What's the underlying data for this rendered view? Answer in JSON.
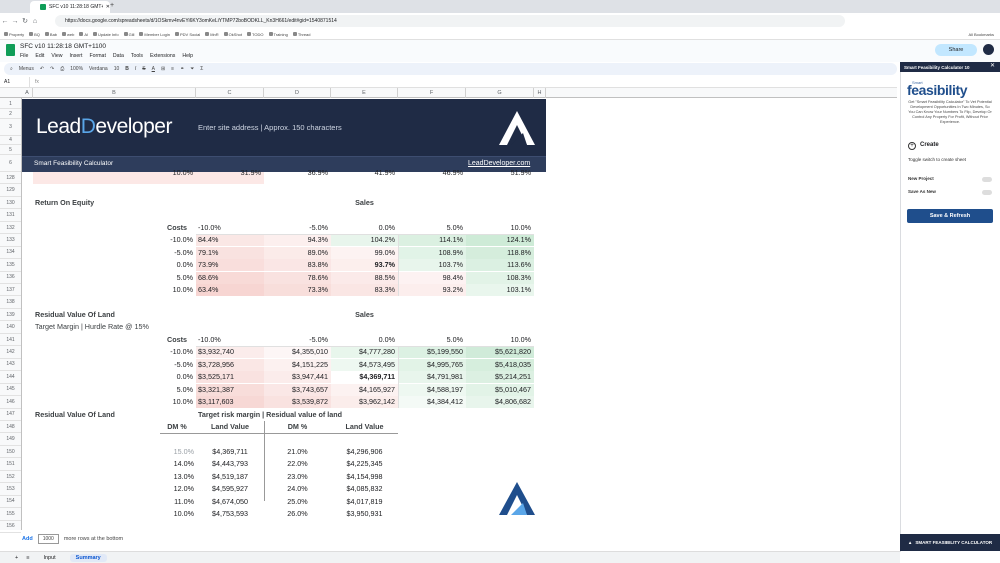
{
  "browser": {
    "tab_title": "SFC v10 11:28:18 GMT+1100",
    "url": "https://docs.google.com/spreadsheets/d/1OSkmv4nvEYi6KY3omKeLiYTMP72boBODKLL_Kn3H661/edit#gid=1540871514",
    "bookmarks": [
      "Property",
      "BQ",
      "Bab",
      "web",
      "Al",
      "Update Info",
      "Gill",
      "Member Login",
      "PDV Social",
      "MnR",
      "OkShot",
      "TODO",
      "Training",
      "Thread"
    ],
    "all_bookmarks": "All Bookmarks"
  },
  "sheet": {
    "title": "SFC v10 11:28:18 GMT+1100",
    "menus": [
      "File",
      "Edit",
      "View",
      "Insert",
      "Format",
      "Data",
      "Tools",
      "Extensions",
      "Help"
    ],
    "share_label": "Share",
    "toolbar": {
      "menus_label": "Menus",
      "zoom": "100%",
      "font": "Verdana",
      "font_size": "10",
      "bold": "B",
      "italic": "I",
      "strike": "S",
      "textcolor": "A"
    },
    "namebox": "A1",
    "fx": "fx",
    "columns": [
      "A",
      "B",
      "C",
      "D",
      "E",
      "F",
      "G",
      "H"
    ],
    "rows": [
      "1",
      "2",
      "3",
      "4",
      "5",
      "6",
      "128",
      "129",
      "130",
      "131",
      "132",
      "133",
      "134",
      "135",
      "136",
      "137",
      "138",
      "139",
      "140",
      "141",
      "142",
      "143",
      "144",
      "145",
      "146",
      "147",
      "148",
      "149",
      "150",
      "151",
      "152",
      "153",
      "154",
      "155",
      "156"
    ],
    "add_label": "Add",
    "add_count": "1000",
    "add_suffix": "more rows at the bottom",
    "tabs": [
      "Input",
      "Summary"
    ]
  },
  "banner": {
    "logo_lead": "Lead",
    "logo_d": "D",
    "logo_rest": "eveloper",
    "address_placeholder": "Enter site address | Approx. 150 characters",
    "calc_title": "Smart Feasibility Calculator",
    "link": "LeadDeveloper.com"
  },
  "partial_row": [
    "10.0%",
    "31.9%",
    "36.9%",
    "41.9%",
    "46.9%",
    "51.9%"
  ],
  "roe": {
    "title": "Return On Equity",
    "sales_label": "Sales",
    "costs_label": "Costs",
    "cols": [
      "-10.0%",
      "-5.0%",
      "0.0%",
      "5.0%",
      "10.0%"
    ],
    "rows": [
      {
        "cost": "-10.0%",
        "vals": [
          "84.4%",
          "94.3%",
          "104.2%",
          "114.1%",
          "124.1%"
        ]
      },
      {
        "cost": "-5.0%",
        "vals": [
          "79.1%",
          "89.0%",
          "99.0%",
          "108.9%",
          "118.8%"
        ]
      },
      {
        "cost": "0.0%",
        "vals": [
          "73.9%",
          "83.8%",
          "93.7%",
          "103.7%",
          "113.6%"
        ]
      },
      {
        "cost": "5.0%",
        "vals": [
          "68.6%",
          "78.6%",
          "88.5%",
          "98.4%",
          "108.3%"
        ]
      },
      {
        "cost": "10.0%",
        "vals": [
          "63.4%",
          "73.3%",
          "83.3%",
          "93.2%",
          "103.1%"
        ]
      }
    ]
  },
  "rvl": {
    "title": "Residual Value Of Land",
    "subtitle": "Target Margin | Hurdle Rate @ 15%",
    "sales_label": "Sales",
    "costs_label": "Costs",
    "cols": [
      "-10.0%",
      "-5.0%",
      "0.0%",
      "5.0%",
      "10.0%"
    ],
    "rows": [
      {
        "cost": "-10.0%",
        "vals": [
          "$3,932,740",
          "$4,355,010",
          "$4,777,280",
          "$5,199,550",
          "$5,621,820"
        ]
      },
      {
        "cost": "-5.0%",
        "vals": [
          "$3,728,956",
          "$4,151,225",
          "$4,573,495",
          "$4,995,765",
          "$5,418,035"
        ]
      },
      {
        "cost": "0.0%",
        "vals": [
          "$3,525,171",
          "$3,947,441",
          "$4,369,711",
          "$4,791,981",
          "$5,214,251"
        ]
      },
      {
        "cost": "5.0%",
        "vals": [
          "$3,321,387",
          "$3,743,657",
          "$4,165,927",
          "$4,588,197",
          "$5,010,467"
        ]
      },
      {
        "cost": "10.0%",
        "vals": [
          "$3,117,603",
          "$3,539,872",
          "$3,962,142",
          "$4,384,412",
          "$4,806,682"
        ]
      }
    ]
  },
  "rvl2": {
    "title": "Residual Value Of Land",
    "subtitle": "Target risk margin | Residual value of land",
    "h_dm": "DM %",
    "h_land": "Land Value",
    "rows": [
      {
        "dm1": "15.0%",
        "lv1": "$4,369,711",
        "dm2": "21.0%",
        "lv2": "$4,296,906"
      },
      {
        "dm1": "14.0%",
        "lv1": "$4,443,793",
        "dm2": "22.0%",
        "lv2": "$4,225,345"
      },
      {
        "dm1": "13.0%",
        "lv1": "$4,519,187",
        "dm2": "23.0%",
        "lv2": "$4,154,998"
      },
      {
        "dm1": "12.0%",
        "lv1": "$4,595,927",
        "dm2": "24.0%",
        "lv2": "$4,085,832"
      },
      {
        "dm1": "11.0%",
        "lv1": "$4,674,050",
        "dm2": "25.0%",
        "lv2": "$4,017,819"
      },
      {
        "dm1": "10.0%",
        "lv1": "$4,753,593",
        "dm2": "26.0%",
        "lv2": "$3,950,931"
      }
    ]
  },
  "panel": {
    "header": "Smart Feasibility Calculator 10",
    "close": "✕",
    "smart": "Smart",
    "feasibility": "feasibility",
    "tagline": "Get \"Smart Feasibility Calculator\" To Vet Potential Development Opportunities In Two Minutes, So You Can Know Your Numbers To Flip, Develop Or Control Any Property For Profit, Without Prior Experience.",
    "create": "Create",
    "toggle_hint": "Toggle switch to create sheet",
    "new_project": "New Project",
    "save_as_new": "Save As New",
    "save_refresh": "Save & Refresh",
    "footer": "SMART FEASIBILITY CALCULATOR"
  },
  "colors": {
    "navy": "#1f2b45",
    "accent": "#5aa6e8",
    "green_heat": "#e6f4ea",
    "red_heat": "#fce8e6",
    "button": "#1f4e8c"
  }
}
